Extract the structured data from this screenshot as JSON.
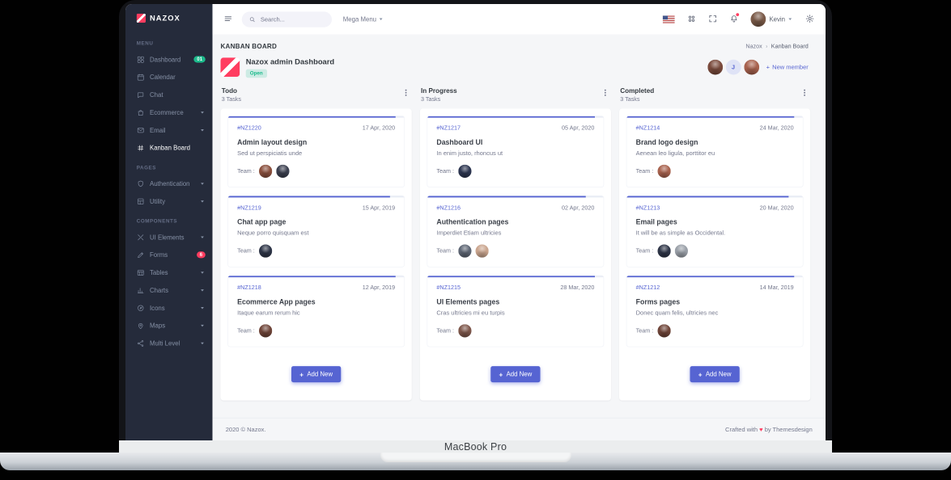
{
  "device": {
    "label": "MacBook Pro"
  },
  "colors": {
    "primary": "#5664d2",
    "danger": "#ff3d60",
    "success": "#1cbb8c",
    "sidebar_bg": "#252b3b"
  },
  "sidebar": {
    "logo": "NAZOX",
    "sections": [
      {
        "label": "MENU",
        "items": [
          {
            "label": "Dashboard",
            "icon": "dashboard",
            "badge": "01",
            "badge_color": "#1cbb8c"
          },
          {
            "label": "Calendar",
            "icon": "calendar"
          },
          {
            "label": "Chat",
            "icon": "chat"
          },
          {
            "label": "Ecommerce",
            "icon": "ecommerce",
            "chevron": true
          },
          {
            "label": "Email",
            "icon": "email",
            "chevron": true
          },
          {
            "label": "Kanban Board",
            "icon": "kanban",
            "active": true
          }
        ]
      },
      {
        "label": "PAGES",
        "items": [
          {
            "label": "Authentication",
            "icon": "auth",
            "chevron": true
          },
          {
            "label": "Utility",
            "icon": "utility",
            "chevron": true
          }
        ]
      },
      {
        "label": "COMPONENTS",
        "items": [
          {
            "label": "UI Elements",
            "icon": "ui",
            "chevron": true
          },
          {
            "label": "Forms",
            "icon": "forms",
            "badge": "6",
            "badge_color": "#ff3d60"
          },
          {
            "label": "Tables",
            "icon": "tables",
            "chevron": true
          },
          {
            "label": "Charts",
            "icon": "charts",
            "chevron": true
          },
          {
            "label": "Icons",
            "icon": "icons",
            "chevron": true
          },
          {
            "label": "Maps",
            "icon": "maps",
            "chevron": true
          },
          {
            "label": "Multi Level",
            "icon": "multi",
            "chevron": true
          }
        ]
      }
    ]
  },
  "topbar": {
    "search_placeholder": "Search...",
    "mega_menu_label": "Mega Menu",
    "user_name": "Kevin",
    "user_avatar_color": "#7a5a48",
    "icons": [
      "menu-icon",
      "us-flag-icon",
      "apps-grid-icon",
      "fullscreen-icon",
      "notifications-bell-icon",
      "settings-gear-icon"
    ]
  },
  "page": {
    "title": "KANBAN BOARD",
    "breadcrumb": [
      "Nazox",
      "Kanban Board"
    ],
    "breadcrumb_separator": "›"
  },
  "board": {
    "title": "Nazox admin Dashboard",
    "status": "Open",
    "plus": "+",
    "new_member_label": "New member",
    "team_label": "Team :",
    "members": [
      {
        "type": "photo",
        "color": "#7a4a3c"
      },
      {
        "type": "initial",
        "label": "J"
      },
      {
        "type": "photo",
        "color": "#a8624e"
      }
    ],
    "columns": [
      {
        "name": "Todo",
        "count": "3 Tasks",
        "add_label": "Add New",
        "cards": [
          {
            "id": "#NZ1220",
            "date": "17 Apr, 2020",
            "title": "Admin layout design",
            "desc": "Sed ut perspiciatis unde",
            "progress": 95,
            "avatars": [
              "#8a4f3d",
              "#3b3f4f"
            ]
          },
          {
            "id": "#NZ1219",
            "date": "15 Apr, 2019",
            "title": "Chat app page",
            "desc": "Neque porro quisquam est",
            "progress": 92,
            "avatars": [
              "#2e3547"
            ]
          },
          {
            "id": "#NZ1218",
            "date": "12 Apr, 2019",
            "title": "Ecommerce App pages",
            "desc": "Itaque earum rerum hic",
            "progress": 95,
            "avatars": [
              "#6e4438"
            ]
          }
        ]
      },
      {
        "name": "In Progress",
        "count": "3 Tasks",
        "add_label": "Add New",
        "cards": [
          {
            "id": "#NZ1217",
            "date": "05 Apr, 2020",
            "title": "Dashboard UI",
            "desc": "In enim justo, rhoncus ut",
            "progress": 95,
            "avatars": [
              "#2c3550"
            ]
          },
          {
            "id": "#NZ1216",
            "date": "02 Apr, 2020",
            "title": "Authentication pages",
            "desc": "Imperdiet Etiam ultricies",
            "progress": 90,
            "avatars": [
              "#5d6573",
              "#caa58e"
            ]
          },
          {
            "id": "#NZ1215",
            "date": "28 Mar, 2020",
            "title": "UI Elements pages",
            "desc": "Cras ultricies mi eu turpis",
            "progress": 95,
            "avatars": [
              "#7d564a"
            ]
          }
        ]
      },
      {
        "name": "Completed",
        "count": "3 Tasks",
        "add_label": "Add New",
        "cards": [
          {
            "id": "#NZ1214",
            "date": "24 Mar, 2020",
            "title": "Brand logo design",
            "desc": "Aenean leo ligula, porttitor eu",
            "progress": 95,
            "avatars": [
              "#a8624e"
            ]
          },
          {
            "id": "#NZ1213",
            "date": "20 Mar, 2020",
            "title": "Email pages",
            "desc": "It will be as simple as Occidental.",
            "progress": 92,
            "avatars": [
              "#2e3547",
              "#9aa0a8"
            ]
          },
          {
            "id": "#NZ1212",
            "date": "14 Mar, 2019",
            "title": "Forms pages",
            "desc": "Donec quam felis, ultricies nec",
            "progress": 95,
            "avatars": [
              "#6e4438"
            ]
          }
        ]
      }
    ]
  },
  "footer": {
    "left": "2020 © Nazox.",
    "right_prefix": "Crafted with",
    "heart": "♥",
    "right_suffix": "by Themesdesign"
  }
}
